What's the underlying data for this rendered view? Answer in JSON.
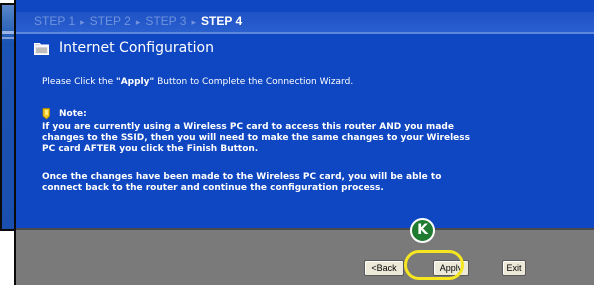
{
  "wizard": {
    "steps": [
      "STEP 1",
      "STEP 2",
      "STEP 3",
      "STEP 4"
    ],
    "step_separator": "▸",
    "title": "Internet Configuration",
    "instruction_prefix": "Please Click the ",
    "instruction_keyword": "\"Apply\"",
    "instruction_suffix": " Button to Complete the Connection Wizard.",
    "note_label": "Note:",
    "note_lines": [
      "If you are currently using a Wireless PC card to access this router AND you made",
      "changes to the SSID, then you will need to make the same changes to your Wireless",
      "PC card AFTER you click the Finish Button."
    ],
    "followup_lines": [
      "Once the changes have been made to the Wireless PC card, you will be able to",
      "connect back to the router and continue the configuration process."
    ]
  },
  "buttons": {
    "back": "<Back",
    "apply": "Apply",
    "exit": "Exit"
  },
  "callout": {
    "label": "K",
    "highlight_color": "#f6e61f",
    "badge_color": "#1e7b2f"
  },
  "colors": {
    "panel_blue": "#0f47c2",
    "button_bar_grey": "#7a7a7a",
    "inactive_step": "#6f93dc"
  },
  "icons": {
    "title": "folder-icon",
    "note": "note-icon"
  }
}
